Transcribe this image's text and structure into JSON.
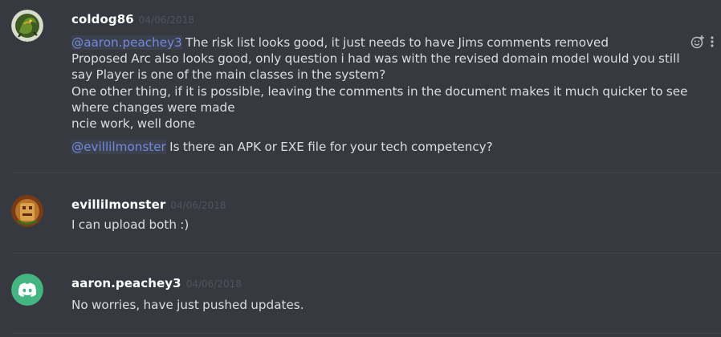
{
  "messages": [
    {
      "username": "coldog86",
      "timestamp": "04/06/2018",
      "lines": [
        {
          "mention": "@aaron.peachey3",
          "text": " The risk list looks good, it just needs to have Jims comments removed\nProposed Arc also looks good, only question i had was with the revised domain model would you still say Player is one of the main classes in the system?\nOne other thing, if it is possible, leaving the comments in the document makes it much quicker to see where changes were made\nncie work, well done"
        },
        {
          "mention": "@evillilmonster",
          "text": " Is there an APK or EXE file for your tech competency?"
        }
      ],
      "actions": [
        "add-reaction-icon",
        "more-options-icon"
      ]
    },
    {
      "username": "evillilmonster",
      "timestamp": "04/06/2018",
      "lines": [
        {
          "text": "I can upload both :)"
        }
      ]
    },
    {
      "username": "aaron.peachey3",
      "timestamp": "04/06/2018",
      "lines": [
        {
          "text": "No worries, have just pushed updates."
        }
      ]
    }
  ],
  "colors": {
    "background": "#36393f",
    "mention": "#7289da",
    "discord_blurple": "#7289da",
    "timestamp": "#4f545c"
  }
}
